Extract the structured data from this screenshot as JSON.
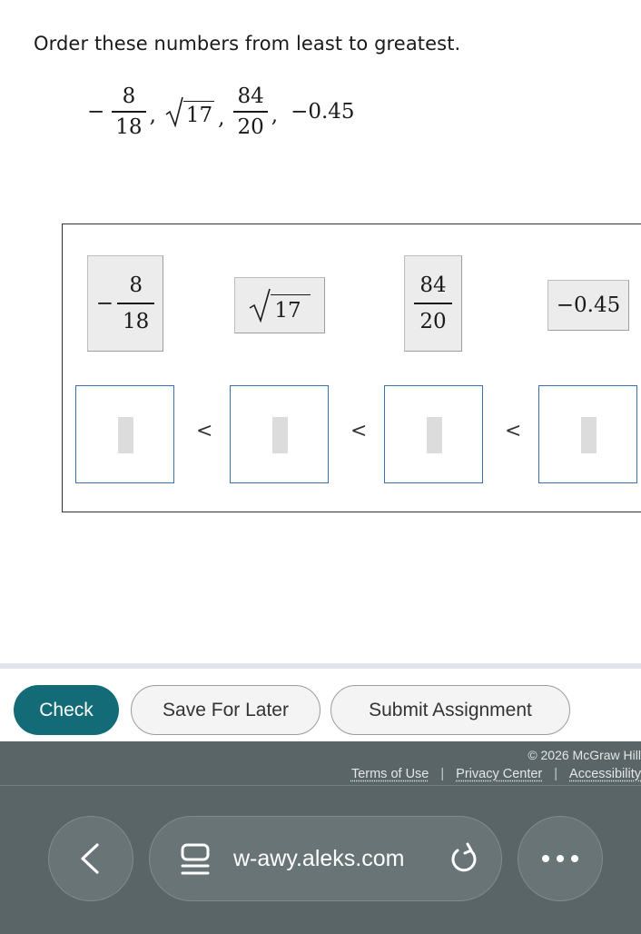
{
  "question": {
    "prompt": "Order these numbers from least to greatest.",
    "expression": {
      "n1_sign": "−",
      "n1_num": "8",
      "n1_den": "18",
      "n2_radicand": "17",
      "n3_num": "84",
      "n3_den": "20",
      "n4": "−0.45",
      "comma": ","
    }
  },
  "tiles": [
    {
      "sign": "−",
      "num": "8",
      "den": "18"
    },
    {
      "radicand": "17"
    },
    {
      "num": "84",
      "den": "20"
    },
    {
      "text": "−0.45"
    }
  ],
  "slots": {
    "separator": "<"
  },
  "actions": {
    "check": "Check",
    "save": "Save For Later",
    "submit": "Submit Assignment"
  },
  "footer": {
    "copyright": "© 2026 McGraw Hill",
    "terms": "Terms of Use",
    "privacy": "Privacy Center",
    "accessibility": "Accessibility",
    "sep": "|"
  },
  "browser": {
    "url": "w-awy.aleks.com"
  },
  "colors": {
    "check_button": "#136b78",
    "slot_border": "#3a6fb0",
    "footer_bg": "#596567"
  }
}
